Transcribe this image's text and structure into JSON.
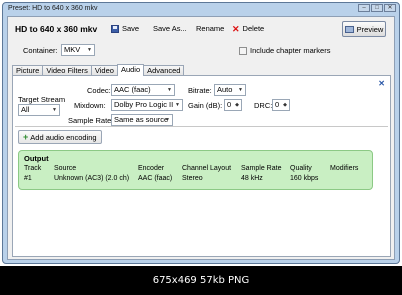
{
  "window": {
    "title": "Preset: HD to 640 x 360 mkv",
    "controls": [
      "–",
      "□",
      "✕"
    ]
  },
  "toolbar": {
    "preset_name": "HD to 640 x 360 mkv",
    "save": "Save",
    "save_as": "Save As...",
    "rename": "Rename",
    "delete": "Delete",
    "preview": "Preview"
  },
  "container": {
    "label": "Container:",
    "value": "MKV"
  },
  "chapter_markers": {
    "label": "Include chapter markers",
    "checked": false
  },
  "tabs": [
    {
      "label": "Picture",
      "active": false
    },
    {
      "label": "Video Filters",
      "active": false
    },
    {
      "label": "Video",
      "active": false
    },
    {
      "label": "Audio",
      "active": true
    },
    {
      "label": "Advanced",
      "active": false
    }
  ],
  "audio": {
    "target_stream_label": "Target Stream",
    "target_stream_value": "All",
    "codec_label": "Codec:",
    "codec_value": "AAC (faac)",
    "bitrate_label": "Bitrate:",
    "bitrate_value": "Auto",
    "mixdown_label": "Mixdown:",
    "mixdown_value": "Dolby Pro Logic II",
    "gain_label": "Gain (dB):",
    "gain_value": "0",
    "drc_label": "DRC:",
    "drc_value": "0",
    "samplerate_label": "Sample Rate:",
    "samplerate_value": "Same as source",
    "close": "✕"
  },
  "add_audio": {
    "label": "Add audio encoding"
  },
  "output": {
    "title": "Output",
    "headers": [
      "Track",
      "Source",
      "Encoder",
      "Channel Layout",
      "Sample Rate",
      "Quality",
      "Modifiers"
    ],
    "row": [
      "#1",
      "Unknown (AC3) (2.0 ch)",
      "AAC (faac)",
      "Stereo",
      "48 kHz",
      "160 kbps",
      ""
    ]
  },
  "image_caption": "675x469 57kb PNG"
}
